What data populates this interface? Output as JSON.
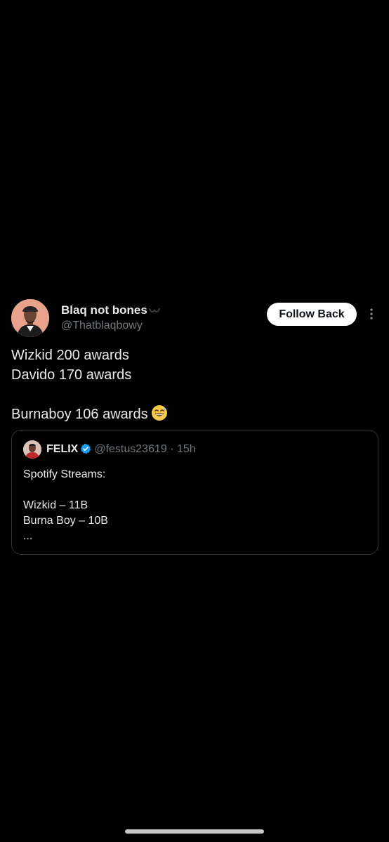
{
  "tweet": {
    "author": {
      "display_name": "Blaq not bones",
      "handle": "@Thatblaqbowy",
      "avatar_icon": "user-avatar-photo",
      "name_emoji_icon": "black-heart-icon"
    },
    "follow_button_label": "Follow Back",
    "more_icon": "more-vertical-icon",
    "text_lines": [
      "Wizkid 200 awards",
      "Davido 170 awards",
      "",
      "Burnaboy 106 awards"
    ],
    "trailing_emoji": "grinning-sweat-laugh-emoji"
  },
  "quote": {
    "display_name": "FELIX",
    "verified": true,
    "handle": "@festus23619",
    "separator": "·",
    "time": "15h",
    "text_lines": [
      "Spotify Streams:",
      "",
      "Wizkid – 11B",
      "Burna Boy – 10B",
      "..."
    ]
  },
  "colors": {
    "background": "#000000",
    "primary_text": "#e7e9ea",
    "secondary_text": "#71767b",
    "border": "#2f3336",
    "verified_blue": "#1d9bf0"
  }
}
